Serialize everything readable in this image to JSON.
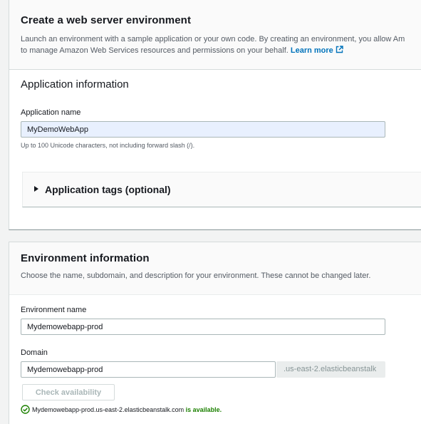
{
  "web_server_panel": {
    "title": "Create a web server environment",
    "desc_line1": "Launch an environment with a sample application or your own code. By creating an environment, you allow Am",
    "desc_line2": "to manage Amazon Web Services resources and permissions on your behalf.",
    "learn_more": "Learn more",
    "link_icon": "external-link-icon"
  },
  "application_info": {
    "heading": "Application information",
    "name_label": "Application name",
    "name_value": "MyDemoWebApp",
    "name_hint": "Up to 100 Unicode characters, not including forward slash (/).",
    "tags_label": "Application tags (optional)",
    "tags_icon": "caret-right-icon"
  },
  "environment_info": {
    "title": "Environment information",
    "description": "Choose the name, subdomain, and description for your environment. These cannot be changed later.",
    "env_name_label": "Environment name",
    "env_name_value": "Mydemowebapp-prod",
    "domain_label": "Domain",
    "domain_value": "Mydemowebapp-prod",
    "domain_suffix": ".us-east-2.elasticbeanstalk",
    "check_button": "Check availability",
    "status_domain": "Mydemowebapp-prod.us-east-2.elasticbeanstalk.com",
    "status_text": "is available.",
    "status_icon": "success-check-icon"
  },
  "colors": {
    "link": "#0073bb",
    "success": "#1d8102",
    "autofill": "#e8f0fe"
  }
}
